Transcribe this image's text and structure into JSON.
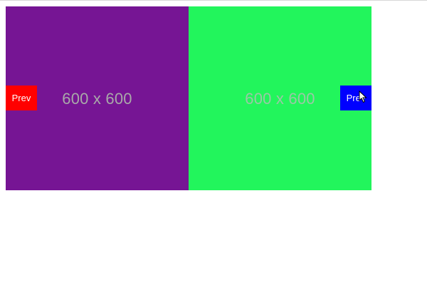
{
  "carousel": {
    "slides": [
      {
        "caption": "600 x 600",
        "color": "#761594"
      },
      {
        "caption": "600 x 600",
        "color": "#22f55c"
      }
    ],
    "buttons": {
      "left_label": "Prev",
      "right_label": "Prev",
      "left_color": "#ff0000",
      "right_color": "#0000ff"
    }
  },
  "cursor": {
    "icon": "pointer-arrow-icon"
  }
}
